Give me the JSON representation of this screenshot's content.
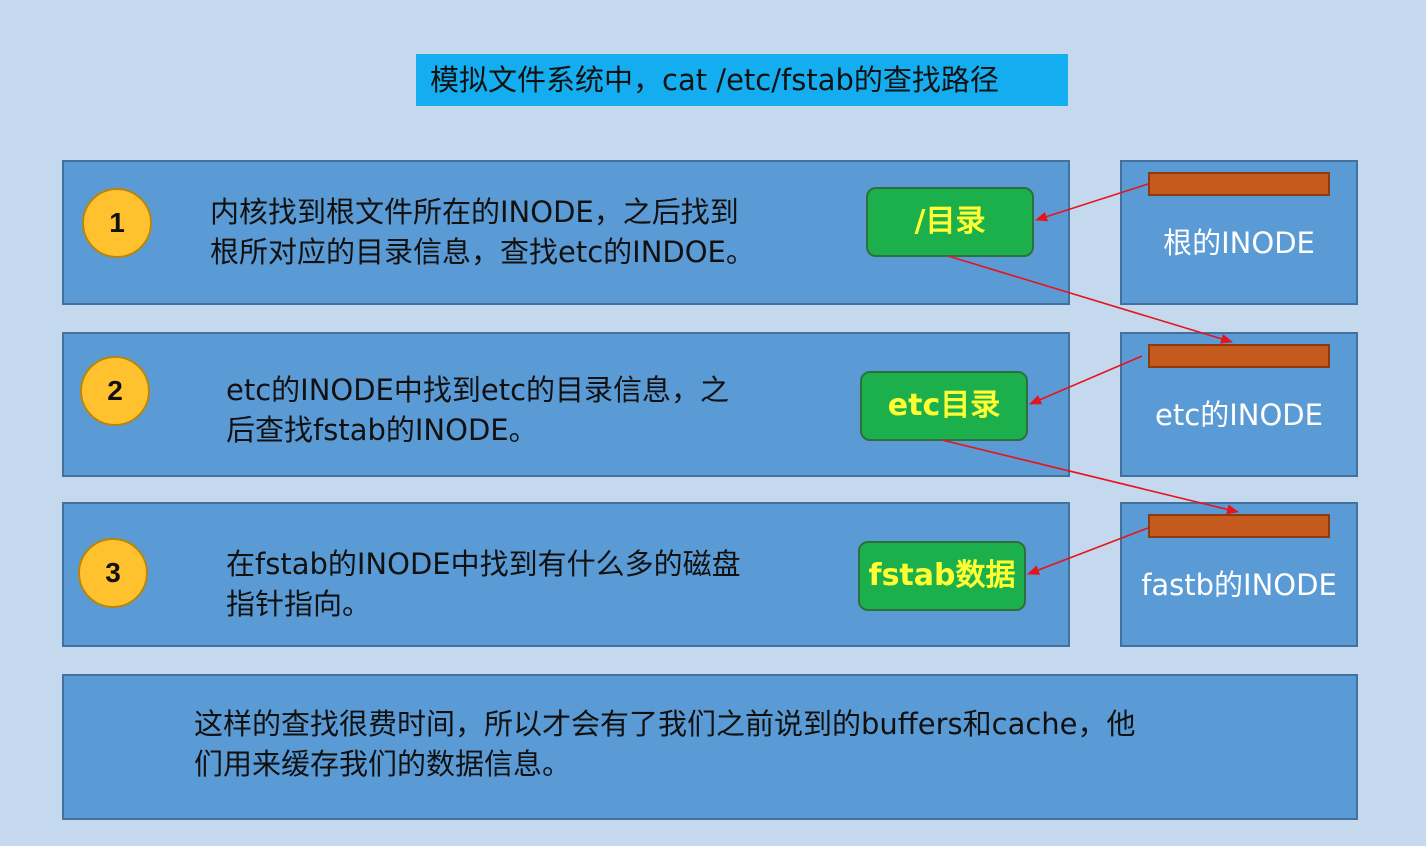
{
  "title": "模拟文件系统中，cat /etc/fstab的查找路径",
  "steps": [
    {
      "number": "1",
      "lines": [
        "内核找到根文件所在的INODE，之后找到",
        "根所对应的目录信息，查找etc的INDOE。"
      ],
      "box": "/目录",
      "inode": "根的INODE"
    },
    {
      "number": "2",
      "lines": [
        "etc的INODE中找到etc的目录信息，之",
        "后查找fstab的INODE。"
      ],
      "box": "etc目录",
      "inode": "etc的INODE"
    },
    {
      "number": "3",
      "lines": [
        "在fstab的INODE中找到有什么多的磁盘",
        "指针指向。"
      ],
      "box": "fstab数据",
      "inode": "fastb的INODE"
    }
  ],
  "footer": [
    "这样的查找很费时间，所以才会有了我们之前说到的buffers和cache，他",
    "们用来缓存我们的数据信息。"
  ],
  "colors": {
    "background": "#c5d9ee",
    "panel": "#5b9bd5",
    "title_bg": "#14aef0",
    "circle": "#ffc12e",
    "green_box": "#1cb04d",
    "inode_bar": "#c55a1e",
    "arrow": "#e8131b"
  }
}
